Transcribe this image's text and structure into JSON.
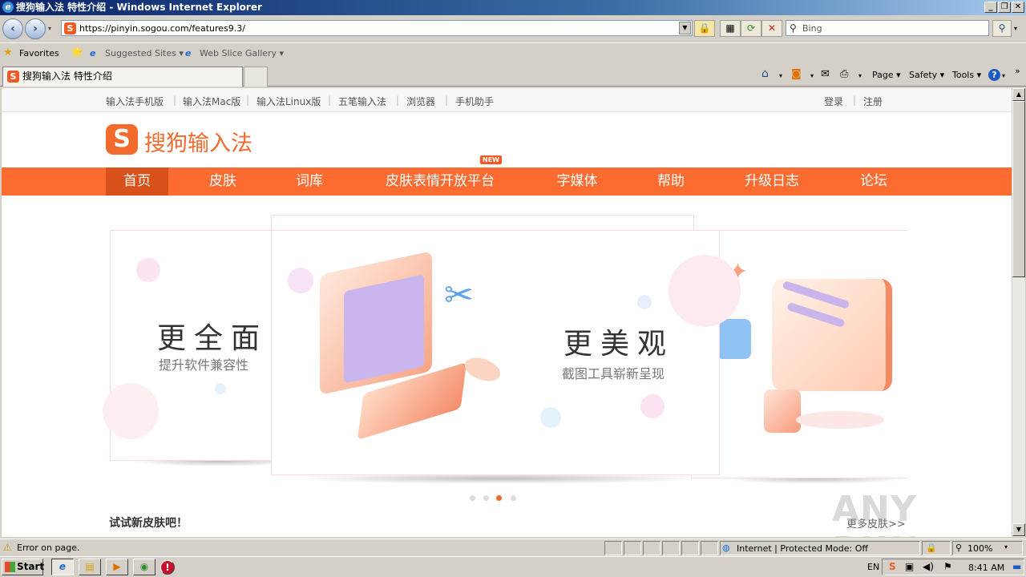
{
  "window": {
    "title": "搜狗输入法 特性介绍 - Windows Internet Explorer",
    "minimize": "_",
    "maximize": "❐",
    "close": "✕"
  },
  "addressbar": {
    "url": "https://pinyin.sogou.com/features9.3/",
    "search_placeholder": "Bing"
  },
  "favorites_bar": {
    "favorites": "Favorites",
    "suggested_sites": "Suggested Sites ▾",
    "web_slice_gallery": "Web Slice Gallery ▾"
  },
  "tab": {
    "title": "搜狗输入法 特性介绍"
  },
  "command_bar": {
    "page": "Page ▾",
    "safety": "Safety ▾",
    "tools": "Tools ▾",
    "help": "?"
  },
  "site": {
    "top_links": [
      "输入法手机版",
      "输入法Mac版",
      "输入法Linux版",
      "五笔输入法",
      "浏览器",
      "手机助手"
    ],
    "login": "登录",
    "register": "注册",
    "logo_mark": "S",
    "logo_text": "搜狗输入法",
    "new_badge": "NEW",
    "nav": [
      "首页",
      "皮肤",
      "词库",
      "皮肤表情开放平台",
      "字媒体",
      "帮助",
      "升级日志",
      "论坛"
    ],
    "slides": {
      "left": {
        "title": "更全面",
        "subtitle": "提升软件兼容性"
      },
      "center": {
        "title": "更美观",
        "subtitle": "截图工具崭新呈现"
      }
    },
    "carousel_active_index": 2,
    "carousel_count": 4,
    "try_new_skins": "试试新皮肤吧！",
    "more_skins": "更多皮肤>>",
    "watermark": "ANY RUN"
  },
  "statusbar": {
    "message": "Error on page.",
    "zone": "Internet | Protected Mode: Off",
    "zoom": "100%"
  },
  "taskbar": {
    "start": "Start",
    "lang": "EN",
    "time": "8:41 AM"
  },
  "colors": {
    "brand_orange": "#fc6b30",
    "nav_active": "#d8501a"
  }
}
